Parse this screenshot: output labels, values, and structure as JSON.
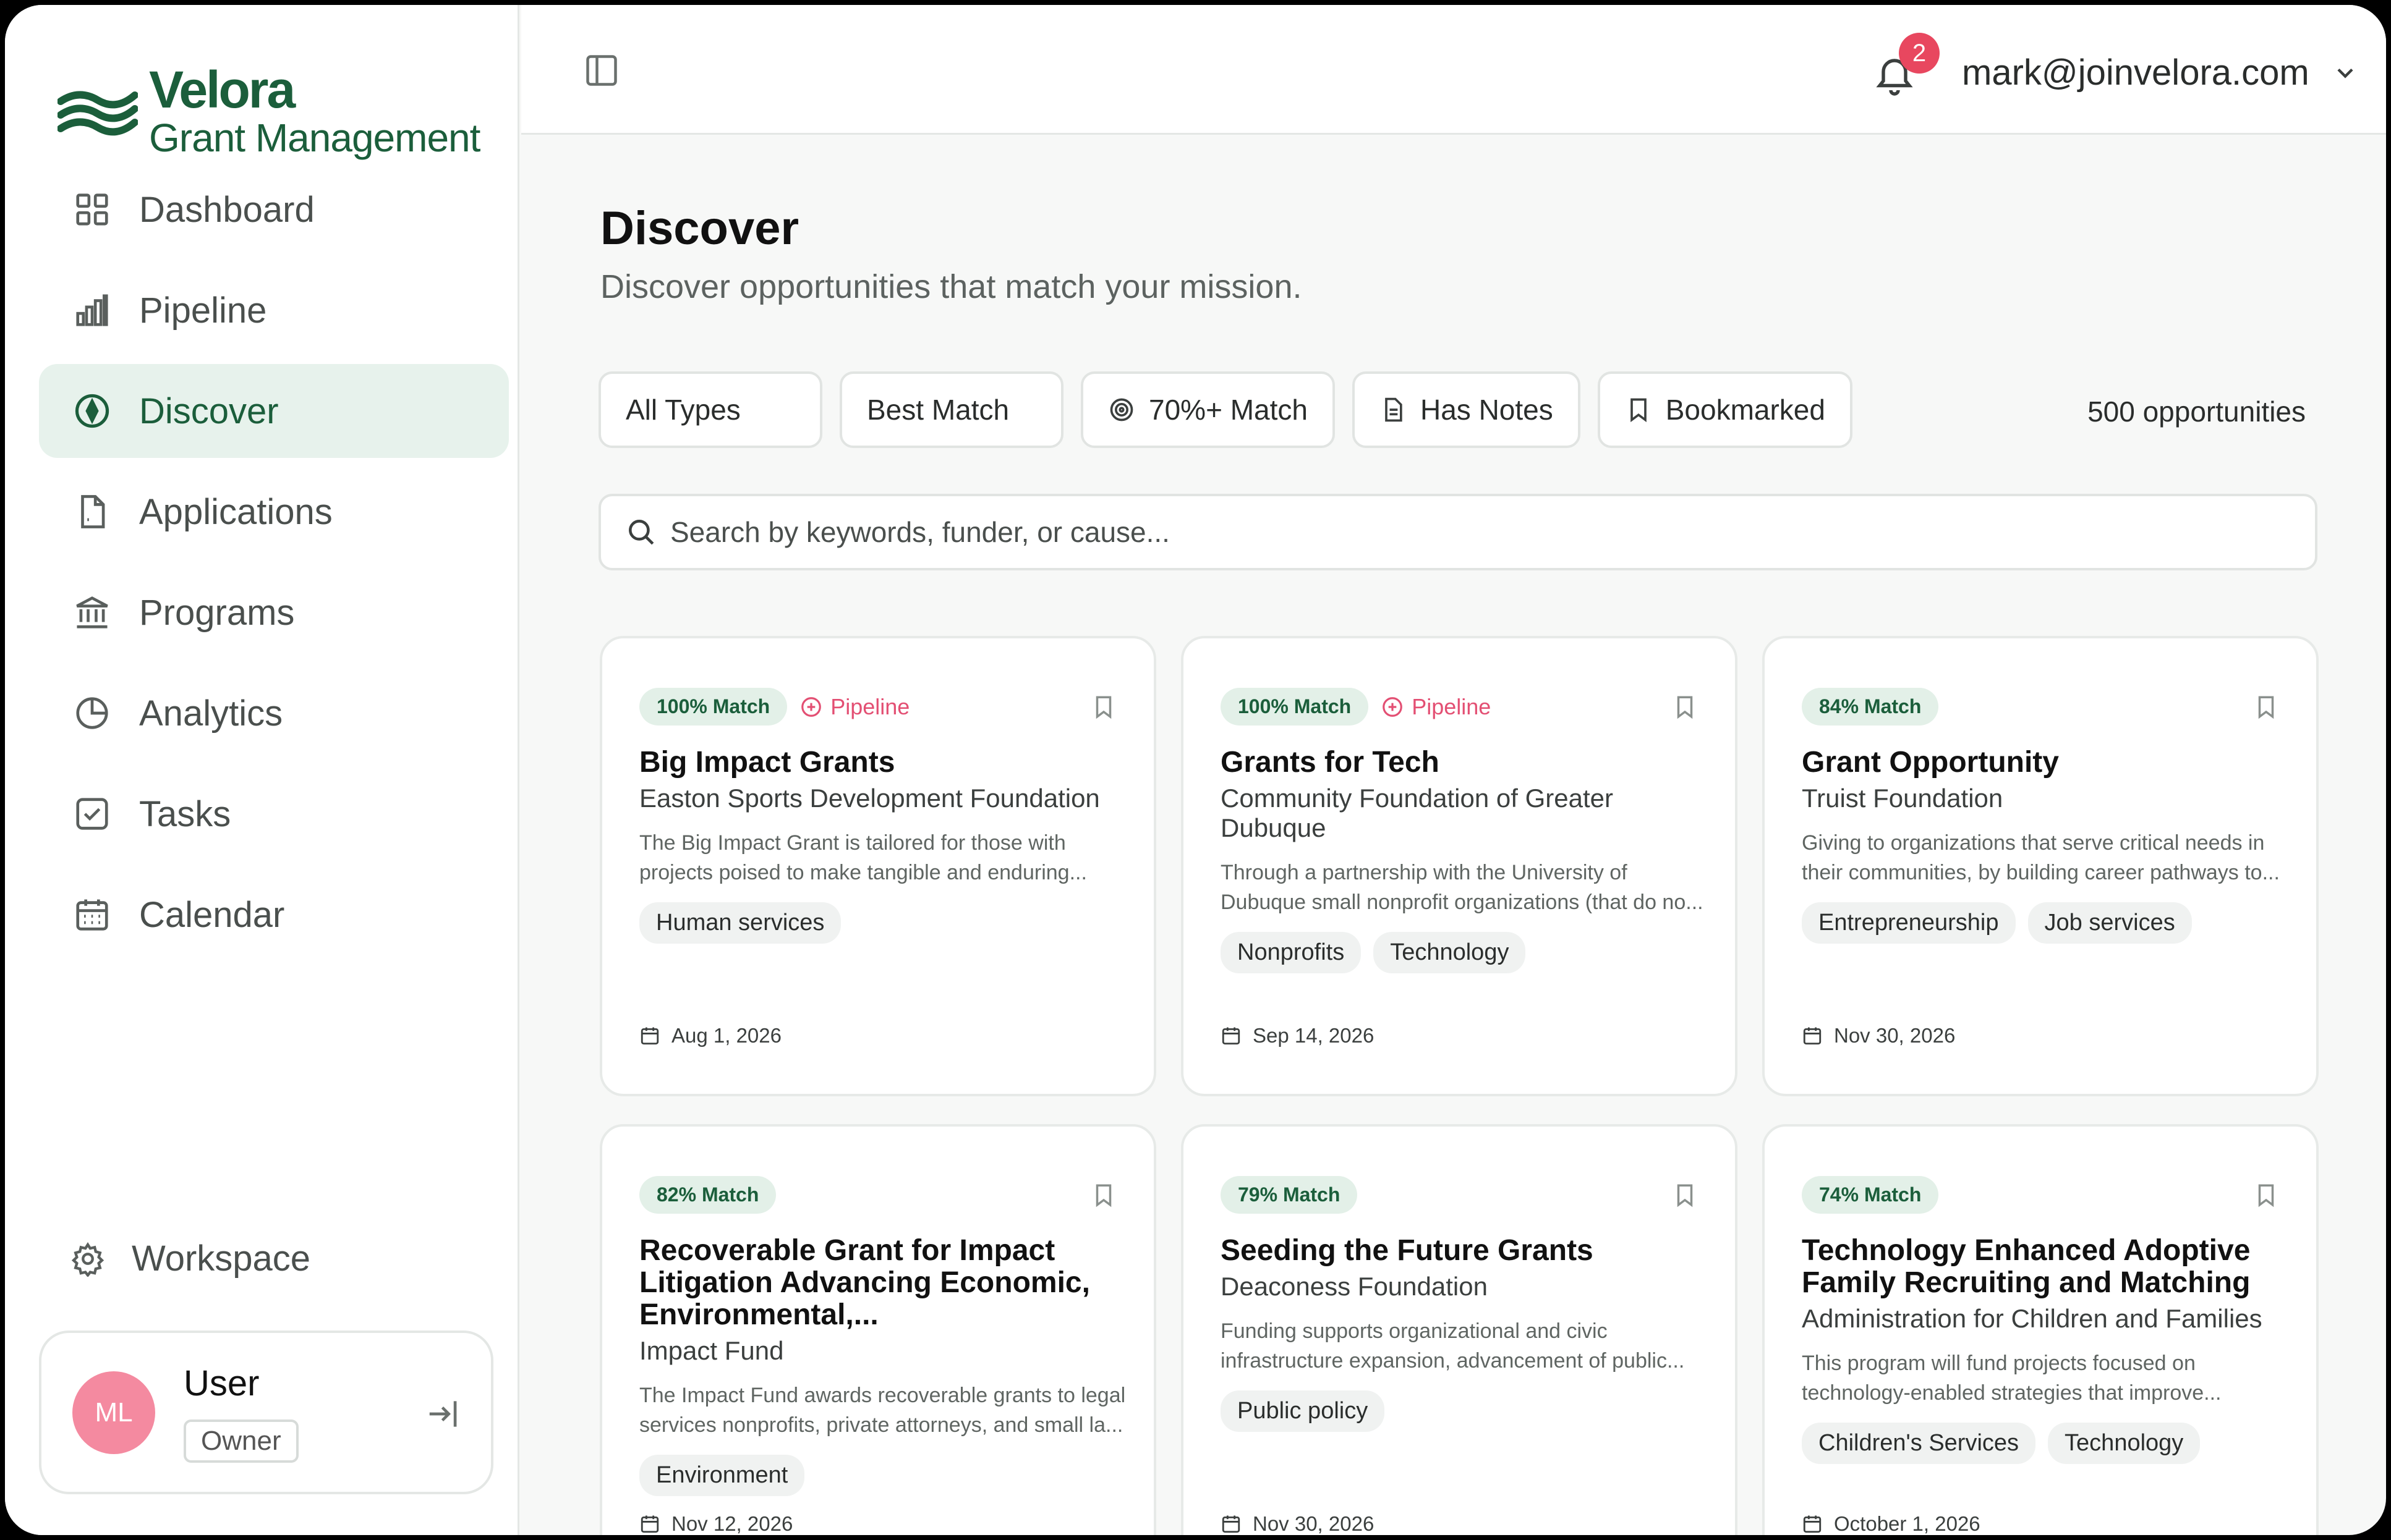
{
  "brand": {
    "name": "Velora",
    "subtitle": "Grant Management",
    "color": "#1b5e3b"
  },
  "sidebar": {
    "items": [
      {
        "label": "Dashboard",
        "icon": "grid-icon",
        "active": false
      },
      {
        "label": "Pipeline",
        "icon": "bar-chart-icon",
        "active": false
      },
      {
        "label": "Discover",
        "icon": "compass-icon",
        "active": true
      },
      {
        "label": "Applications",
        "icon": "file-icon",
        "active": false
      },
      {
        "label": "Programs",
        "icon": "bank-icon",
        "active": false
      },
      {
        "label": "Analytics",
        "icon": "pie-chart-icon",
        "active": false
      },
      {
        "label": "Tasks",
        "icon": "check-square-icon",
        "active": false
      },
      {
        "label": "Calendar",
        "icon": "calendar-icon",
        "active": false
      }
    ],
    "workspace_label": "Workspace",
    "user": {
      "initials": "ML",
      "name": "User",
      "role": "Owner"
    }
  },
  "topbar": {
    "notification_count": "2",
    "account_email": "mark@joinvelora.com"
  },
  "page": {
    "title": "Discover",
    "subtitle": "Discover opportunities that match your mission."
  },
  "filters": {
    "type": "All Types",
    "sort": "Best Match",
    "match": "70%+ Match",
    "notes": "Has Notes",
    "bookmarked": "Bookmarked",
    "count": "500 opportunities"
  },
  "search": {
    "placeholder": "Search by keywords, funder, or cause..."
  },
  "cards": [
    {
      "match": "100% Match",
      "pipeline": "Pipeline",
      "title": "Big Impact Grants",
      "funder": "Easton Sports Development Foundation",
      "description": "The Big Impact Grant is tailored for those with projects poised to make tangible and enduring...",
      "tags": [
        "Human services"
      ],
      "deadline": "Aug 1, 2026"
    },
    {
      "match": "100% Match",
      "pipeline": "Pipeline",
      "title": "Grants for Tech",
      "funder": "Community Foundation of Greater Dubuque",
      "description": "Through a partnership with the University of Dubuque small nonprofit organizations (that do no...",
      "tags": [
        "Nonprofits",
        "Technology"
      ],
      "deadline": "Sep 14, 2026"
    },
    {
      "match": "84% Match",
      "pipeline": "",
      "title": "Grant Opportunity",
      "funder": "Truist Foundation",
      "description": "Giving to organizations that serve critical needs in their communities, by building career pathways to...",
      "tags": [
        "Entrepreneurship",
        "Job services"
      ],
      "deadline": "Nov 30, 2026"
    },
    {
      "match": "82% Match",
      "pipeline": "",
      "title": "Recoverable Grant for Impact Litigation Advancing Economic, Environmental,...",
      "funder": "Impact Fund",
      "description": "The Impact Fund awards recoverable grants to legal services nonprofits, private attorneys, and small la...",
      "tags": [
        "Environment"
      ],
      "deadline": "Nov 12, 2026"
    },
    {
      "match": "79% Match",
      "pipeline": "",
      "title": "Seeding the Future Grants",
      "funder": "Deaconess Foundation",
      "description": "Funding supports organizational and civic infrastructure expansion, advancement of public...",
      "tags": [
        "Public policy"
      ],
      "deadline": "Nov 30, 2026"
    },
    {
      "match": "74% Match",
      "pipeline": "",
      "title": "Technology Enhanced Adoptive Family Recruiting and Matching",
      "funder": "Administration for Children and Families",
      "description": "This program will fund projects focused on technology-enabled strategies that improve...",
      "tags": [
        "Children's Services",
        "Technology"
      ],
      "deadline": "October 1, 2026"
    }
  ]
}
